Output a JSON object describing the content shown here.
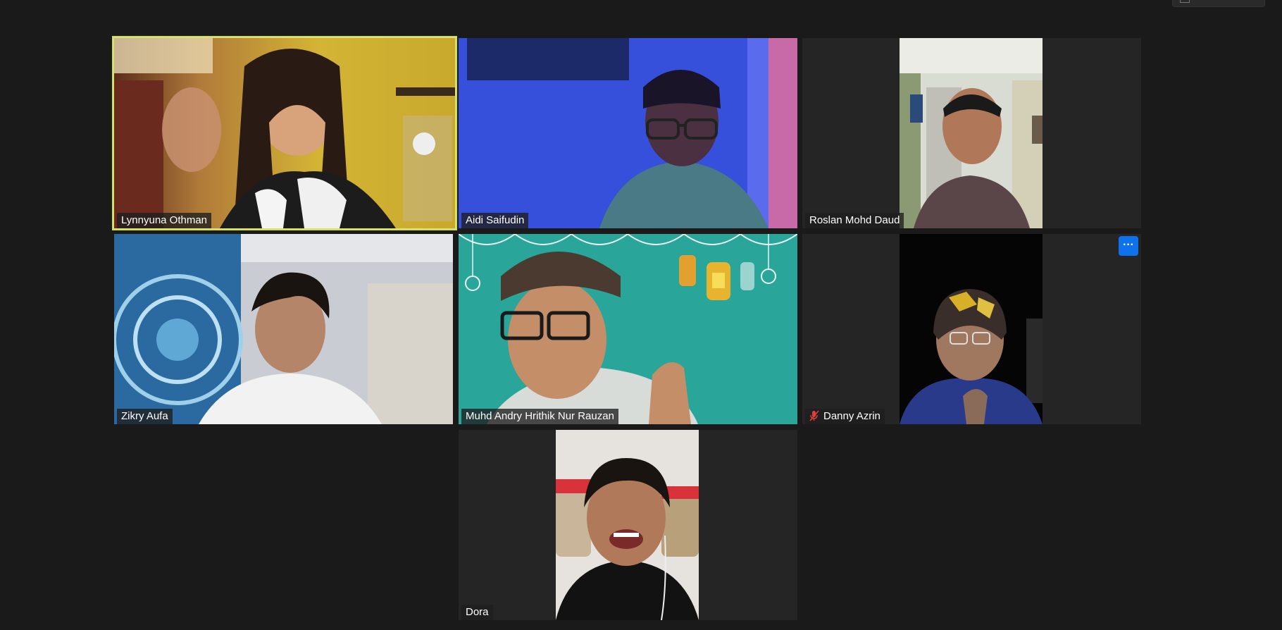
{
  "participants": [
    {
      "name": "Lynnyuna Othman",
      "muted": false,
      "active_speaker": true
    },
    {
      "name": "Aidi Saifudin",
      "muted": false,
      "active_speaker": false
    },
    {
      "name": "Roslan Mohd Daud",
      "muted": false,
      "active_speaker": false
    },
    {
      "name": "Zikry Aufa",
      "muted": false,
      "active_speaker": false
    },
    {
      "name": "Muhd Andry Hrithik Nur Rauzan",
      "muted": false,
      "active_speaker": false
    },
    {
      "name": "Danny Azrin",
      "muted": true,
      "active_speaker": false
    },
    {
      "name": "Dora",
      "muted": false,
      "active_speaker": false
    }
  ],
  "tile_menu": {
    "more_label": "···"
  },
  "colors": {
    "background": "#1a1a1a",
    "tile_background": "#252525",
    "active_border": "#d9e26a",
    "speaking_bar": "#f0d23c",
    "accent": "#0e72ed",
    "muted_icon": "#e03e3e"
  },
  "icons": {
    "muted": "microphone-muted-icon",
    "more": "more-options-icon"
  }
}
